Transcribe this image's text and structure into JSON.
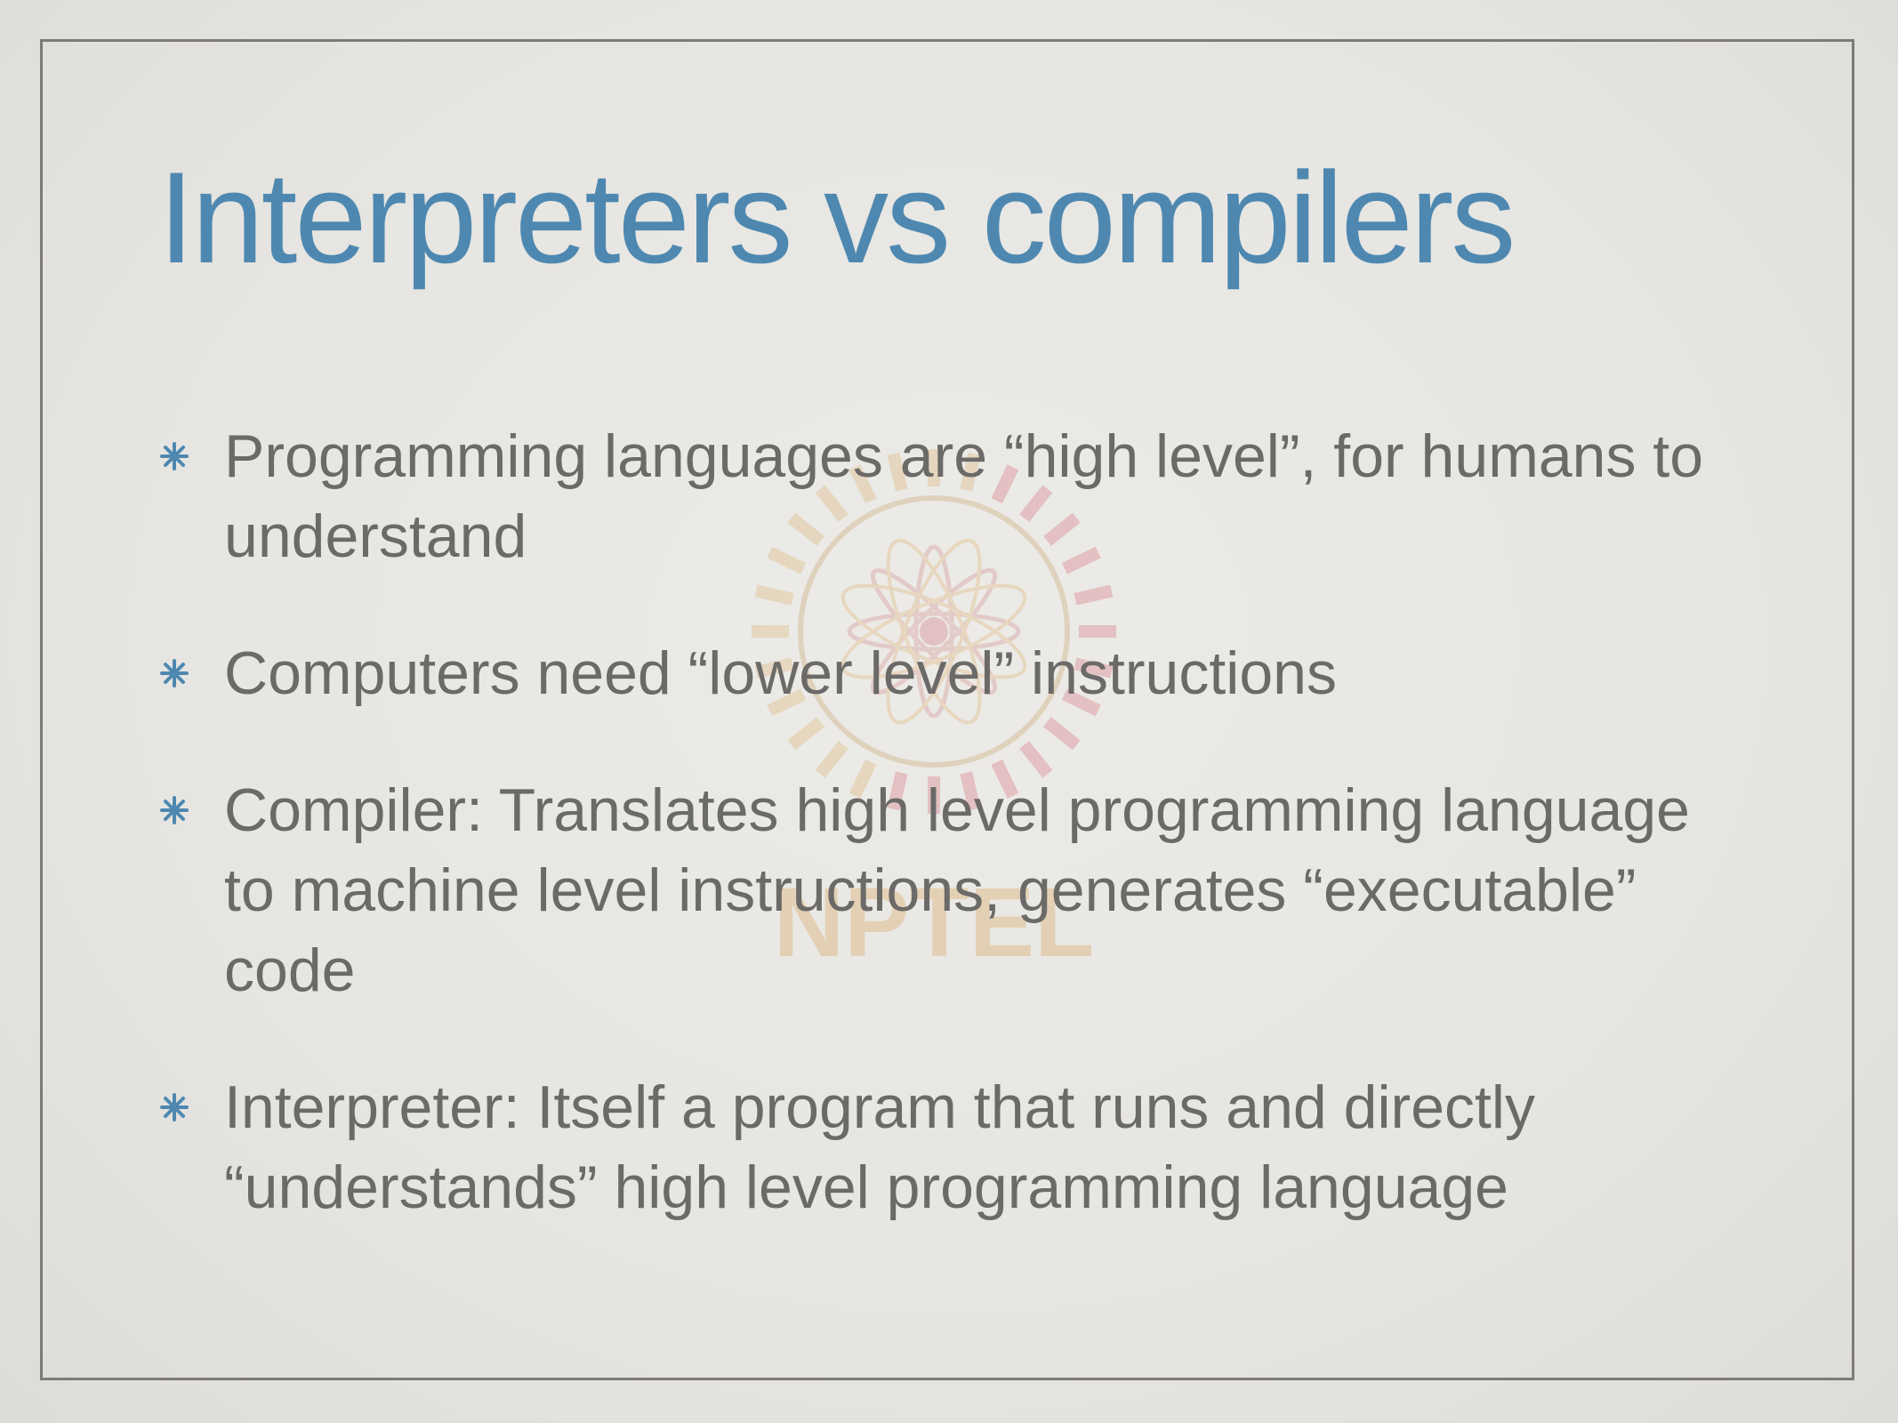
{
  "slide": {
    "title": "Interpreters vs compilers",
    "watermark_text": "NPTEL",
    "bullets": [
      {
        "text": "Programming languages are “high level”, for humans to understand"
      },
      {
        "text": "Computers need “lower level” instructions"
      },
      {
        "text": "Compiler: Translates high level programming language to machine level instructions, generates “executable” code"
      },
      {
        "text": "Interpreter: Itself a program that runs and directly “understands” high level programming language"
      }
    ]
  },
  "colors": {
    "title": "#4e88b0",
    "body_text": "#6b6a68",
    "border": "#7d7b78",
    "background": "#e7e6e2",
    "bullet_marker": "#4e88b0"
  },
  "icons": {
    "bullet": "asterisk-bullet-icon",
    "watermark": "nptel-logo"
  }
}
